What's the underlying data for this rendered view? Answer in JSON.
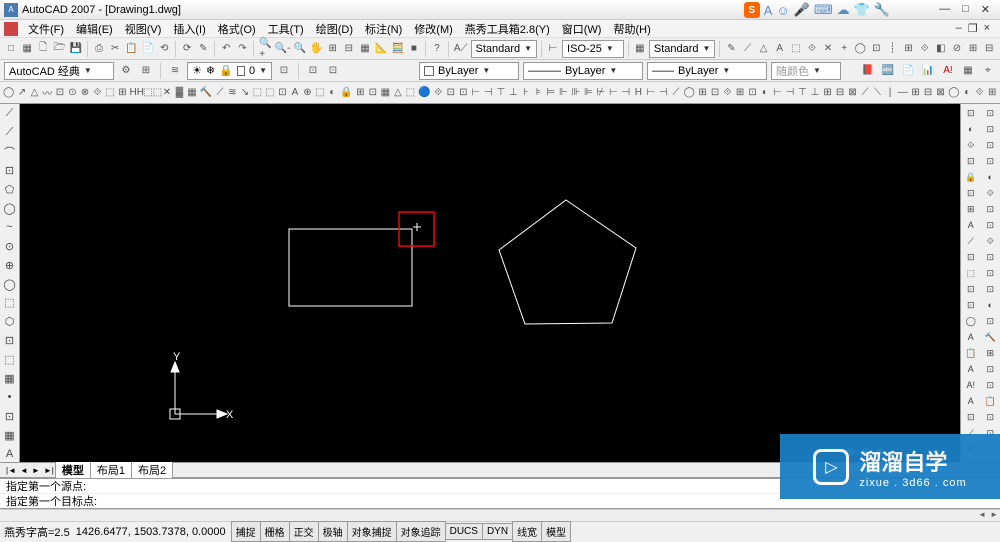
{
  "title": "AutoCAD 2007 - [Drawing1.dwg]",
  "window_buttons": {
    "min": "—",
    "max": "□",
    "close": "✕",
    "min2": "–",
    "max2": "❐",
    "close2": "×"
  },
  "sogou": {
    "s": "S",
    "icons": [
      "A",
      "☺",
      "🎤",
      "⌨",
      "☁",
      "👕",
      "🔧"
    ]
  },
  "menu": {
    "items": [
      "文件(F)",
      "编辑(E)",
      "视图(V)",
      "插入(I)",
      "格式(O)",
      "工具(T)",
      "绘图(D)",
      "标注(N)",
      "修改(M)",
      "燕秀工具箱2.8(Y)",
      "窗口(W)",
      "帮助(H)"
    ]
  },
  "toolbar1": {
    "icons": [
      "□",
      "▦",
      "🗋",
      "🗁",
      "💾",
      "⎙",
      "✂",
      "📋",
      "📄",
      "⟲",
      "⟳",
      "✎",
      "↶",
      "↷",
      "🔍+",
      "🔍-",
      "🔍",
      "🖐",
      "⊞",
      "⊟",
      "▦",
      "📐",
      "🧮",
      "■",
      "?"
    ],
    "style_label": "Standard",
    "dim_label": "ISO-25",
    "table_label": "Standard"
  },
  "toolbar1_right_icons": [
    "✎",
    "⟋",
    "△",
    "A",
    "⬚",
    "⟐",
    "✕",
    "+",
    "◯",
    "⊡",
    "┊",
    "⊞",
    "⟐",
    "◧",
    "⊘",
    "⊞",
    "⊟"
  ],
  "row2": {
    "workspace": "AutoCAD 经典",
    "layer_icons": [
      "☀",
      "❄",
      "🔒",
      "■",
      "0"
    ],
    "bylayer1": "ByLayer",
    "bylayer2": "ByLayer",
    "bylayer3": "ByLayer",
    "color": "随颜色"
  },
  "row2_right_icons": [
    "📕",
    "🔤",
    "📄",
    "📊",
    "A!",
    "▦",
    "⌖"
  ],
  "row3_icons_a": [
    "◯",
    "↗",
    "△",
    "〰",
    "⊡",
    "⊙",
    "⊗",
    "⟐",
    "⬚",
    "⊞",
    "HH",
    "⬚⬚",
    "✕",
    "▓",
    "▦",
    "🔨",
    "⟋",
    "≋",
    "↘",
    "⬚",
    "⬚",
    "⊡",
    "A",
    "⊕",
    "⬚",
    "◐",
    "🔒",
    "⊞",
    "⊡",
    "▦",
    "△",
    "⬚",
    "🔵",
    "⟐",
    "⊡",
    "⊡"
  ],
  "row3_icons_b": [
    "⊢",
    "⊣",
    "⊤",
    "⊥",
    "⊦",
    "⊧",
    "⊨",
    "⊩",
    "⊪",
    "⊫",
    "⊬",
    "⊢",
    "⊣",
    "H",
    "⊢",
    "⊣",
    "⟋",
    "◯",
    "⊞",
    "⊡",
    "⟐",
    "⊞",
    "⊡",
    "◐",
    "⊢",
    "⊣",
    "⊤",
    "⊥",
    "⊞",
    "⊟",
    "⊠",
    "⟋",
    "⟍",
    "|",
    "—",
    "⊞",
    "⊟",
    "⊠",
    "◯",
    "◐",
    "⟐",
    "⊞"
  ],
  "left_tools": [
    "⟋",
    "⟋",
    "⌒",
    "⊡",
    "⬠",
    "◯",
    "~",
    "⊙",
    "⊕",
    "◯",
    "⬚",
    "⬡",
    "⊡",
    "⬚",
    "▦",
    "•",
    "⊡",
    "▦",
    "A"
  ],
  "right_tools_a": [
    "⊡",
    "◐",
    "⟐",
    "⊡",
    "🔒",
    "⊡",
    "⊞",
    "A",
    "⟋",
    "⊡",
    "⬚",
    "⊡",
    "⊡",
    "◯",
    "A",
    "📋",
    "A",
    "A!",
    "A",
    "⊡",
    "⟋",
    "A"
  ],
  "right_tools_b": [
    "⊡",
    "⊡",
    "⊡",
    "⊡",
    "◐",
    "⟐",
    "⊡",
    "⊡",
    "⟐",
    "⊡",
    "⊡",
    "⊡",
    "◐",
    "⊡",
    "🔨",
    "⊞",
    "⊡",
    "⊡",
    "📋",
    "⊡",
    "⊡",
    "⟐"
  ],
  "axes": {
    "y": "Y",
    "x": "X"
  },
  "tabs": {
    "nav": [
      "|◄",
      "◄",
      "►",
      "►|"
    ],
    "model": "模型",
    "layout1": "布局1",
    "layout2": "布局2"
  },
  "cmd": {
    "line1": "指定第一个源点:",
    "line2": "指定第一个目标点:"
  },
  "status": {
    "prefix": "燕秀字高=2.5",
    "coords": "1426.6477, 1503.7378, 0.0000",
    "buttons": [
      "捕捉",
      "栅格",
      "正交",
      "极轴",
      "对象捕捉",
      "对象追踪",
      "DUCS",
      "DYN",
      "线宽",
      "模型"
    ]
  },
  "watermark": {
    "big": "溜溜自学",
    "small": "zixue . 3d66 . com",
    "play": "▷"
  },
  "chart_data": {
    "type": "table",
    "title": "Geometry objects",
    "series": [
      {
        "name": "rectangle",
        "values": [
          [
            289,
            219
          ],
          [
            412,
            219
          ],
          [
            412,
            296
          ],
          [
            289,
            296
          ]
        ]
      },
      {
        "name": "selection-box",
        "values": [
          [
            399,
            202
          ],
          [
            434,
            202
          ],
          [
            434,
            236
          ],
          [
            399,
            236
          ]
        ]
      },
      {
        "name": "pentagon",
        "values": [
          [
            566,
            190
          ],
          [
            636,
            238
          ],
          [
            612,
            313
          ],
          [
            525,
            314
          ],
          [
            499,
            240
          ]
        ]
      }
    ]
  }
}
